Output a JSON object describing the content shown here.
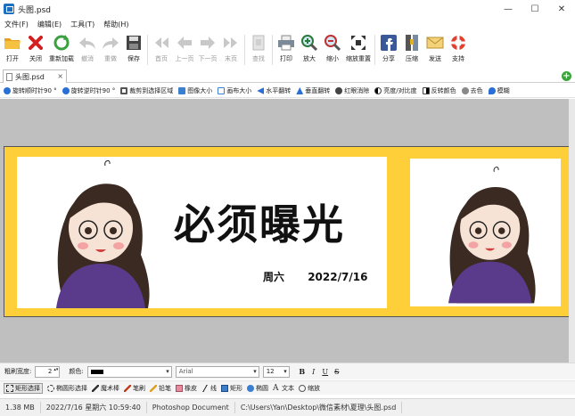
{
  "window": {
    "title": "头图.psd",
    "minimize": "—",
    "maximize": "☐",
    "close": "✕"
  },
  "menu": [
    "文件(F)",
    "编辑(E)",
    "工具(T)",
    "帮助(H)"
  ],
  "toolbar": [
    {
      "label": "打开",
      "icon": "folder-open-icon",
      "enabled": true
    },
    {
      "label": "关闭",
      "icon": "close-x-icon",
      "enabled": true
    },
    {
      "label": "重新加载",
      "icon": "reload-icon",
      "enabled": true
    },
    {
      "label": "撤消",
      "icon": "undo-icon",
      "enabled": false
    },
    {
      "label": "重做",
      "icon": "redo-icon",
      "enabled": false
    },
    {
      "label": "保存",
      "icon": "save-disk-icon",
      "enabled": true
    },
    {
      "label": "首页",
      "icon": "first-page-icon",
      "enabled": false
    },
    {
      "label": "上一页",
      "icon": "prev-page-icon",
      "enabled": false
    },
    {
      "label": "下一页",
      "icon": "next-page-icon",
      "enabled": false
    },
    {
      "label": "末页",
      "icon": "last-page-icon",
      "enabled": false
    },
    {
      "label": "查找",
      "icon": "find-icon",
      "enabled": false
    },
    {
      "label": "打印",
      "icon": "printer-icon",
      "enabled": true
    },
    {
      "label": "放大",
      "icon": "zoom-in-icon",
      "enabled": true
    },
    {
      "label": "缩小",
      "icon": "zoom-out-icon",
      "enabled": true
    },
    {
      "label": "缩放重置",
      "icon": "zoom-reset-icon",
      "enabled": true
    },
    {
      "label": "分享",
      "icon": "facebook-share-icon",
      "enabled": true
    },
    {
      "label": "压缩",
      "icon": "compress-archive-icon",
      "enabled": true
    },
    {
      "label": "发送",
      "icon": "mail-envelope-icon",
      "enabled": true
    },
    {
      "label": "支持",
      "icon": "lifebuoy-support-icon",
      "enabled": true
    }
  ],
  "tab": {
    "label": "头图.psd",
    "close": "×",
    "add": "+"
  },
  "image_tools": [
    {
      "label": "旋转顺时针90 °",
      "icon": "rotate-cw-icon",
      "color": "#2a6fd6"
    },
    {
      "label": "旋转逆时针90 °",
      "icon": "rotate-ccw-icon",
      "color": "#2a6fd6"
    },
    {
      "label": "裁剪到选择区域",
      "icon": "crop-icon",
      "color": "#555555"
    },
    {
      "label": "图像大小",
      "icon": "image-size-icon",
      "color": "#3a7fd0"
    },
    {
      "label": "画布大小",
      "icon": "canvas-size-icon",
      "color": "#3a7fd0"
    },
    {
      "label": "水平翻转",
      "icon": "flip-horizontal-icon",
      "color": "#2a6fd6"
    },
    {
      "label": "垂直翻转",
      "icon": "flip-vertical-icon",
      "color": "#2a6fd6"
    },
    {
      "label": "红眼消除",
      "icon": "red-eye-icon",
      "color": "#444444"
    },
    {
      "label": "亮度/对比度",
      "icon": "brightness-icon",
      "color": "#444444"
    },
    {
      "label": "反转颜色",
      "icon": "invert-colors-icon",
      "color": "#444444"
    },
    {
      "label": "去色",
      "icon": "desaturate-icon",
      "color": "#888888"
    },
    {
      "label": "模糊",
      "icon": "blur-icon",
      "color": "#2a6fd6"
    }
  ],
  "image": {
    "headline": "必须曝光",
    "day": "周六",
    "date": "2022/7/16",
    "banner_color": "#ffcf3a"
  },
  "format_bar": {
    "brush_width_label": "粗刷宽度:",
    "brush_width_value": "2",
    "color_label": "颜色:",
    "color_value": "#000000",
    "font": "Arial",
    "font_size": "12",
    "bold": "B",
    "italic": "I",
    "underline": "U",
    "strike": "S"
  },
  "draw_tools": [
    {
      "label": "矩形选择",
      "icon": "rect-select-icon",
      "active": true
    },
    {
      "label": "椭圆形选择",
      "icon": "ellipse-select-icon",
      "active": false
    },
    {
      "label": "魔术棒",
      "icon": "magic-wand-icon",
      "active": false
    },
    {
      "label": "笔刷",
      "icon": "brush-icon",
      "active": false
    },
    {
      "label": "铅笔",
      "icon": "pencil-icon",
      "active": false
    },
    {
      "label": "橡皮",
      "icon": "eraser-icon",
      "active": false
    },
    {
      "label": "线",
      "icon": "line-icon",
      "active": false
    },
    {
      "label": "矩形",
      "icon": "rectangle-icon",
      "active": false
    },
    {
      "label": "椭圆",
      "icon": "ellipse-icon",
      "active": false
    },
    {
      "label": "文本",
      "icon": "text-icon",
      "active": false
    },
    {
      "label": "缩放",
      "icon": "zoom-tool-icon",
      "active": false
    }
  ],
  "status": {
    "file_size": "1.38 MB",
    "modified": "2022/7/16 星期六 10:59:40",
    "type": "Photoshop Document",
    "path": "C:\\Users\\Yan\\Desktop\\微信素材\\夏理\\头图.psd"
  }
}
